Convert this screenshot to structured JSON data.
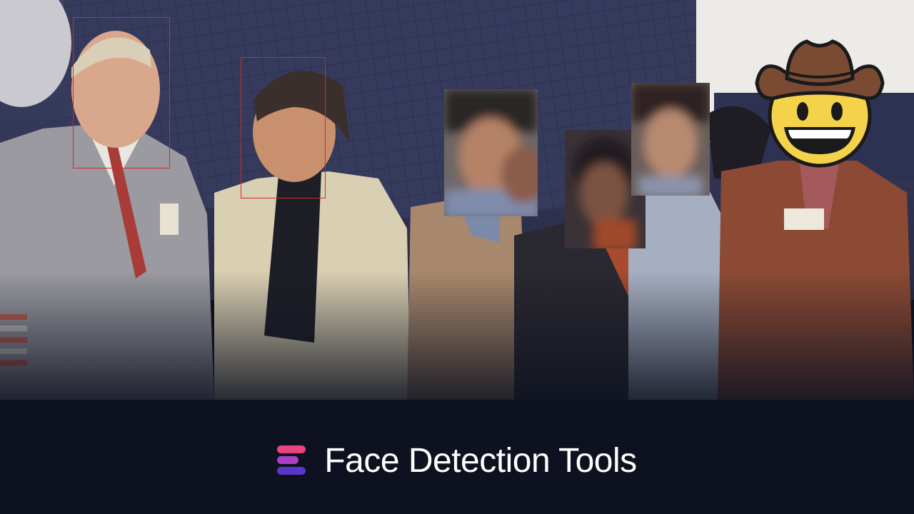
{
  "footer": {
    "title": "Face Detection Tools",
    "logo_icon": "stacked-bars-logo-icon",
    "logo_colors": [
      "#e8457e",
      "#a83fc4",
      "#5a36c8"
    ]
  },
  "photo": {
    "detections": [
      {
        "label": "face-box-1",
        "style": "outline"
      },
      {
        "label": "face-box-2",
        "style": "outline"
      },
      {
        "label": "face-blur-3",
        "style": "pixelated"
      },
      {
        "label": "face-blur-4",
        "style": "pixelated"
      },
      {
        "label": "face-blur-5",
        "style": "pixelated"
      },
      {
        "label": "face-emoji-6",
        "style": "emoji",
        "emoji": "cowboy-hat-face-icon"
      }
    ],
    "outline_color": "#d22a2a"
  }
}
